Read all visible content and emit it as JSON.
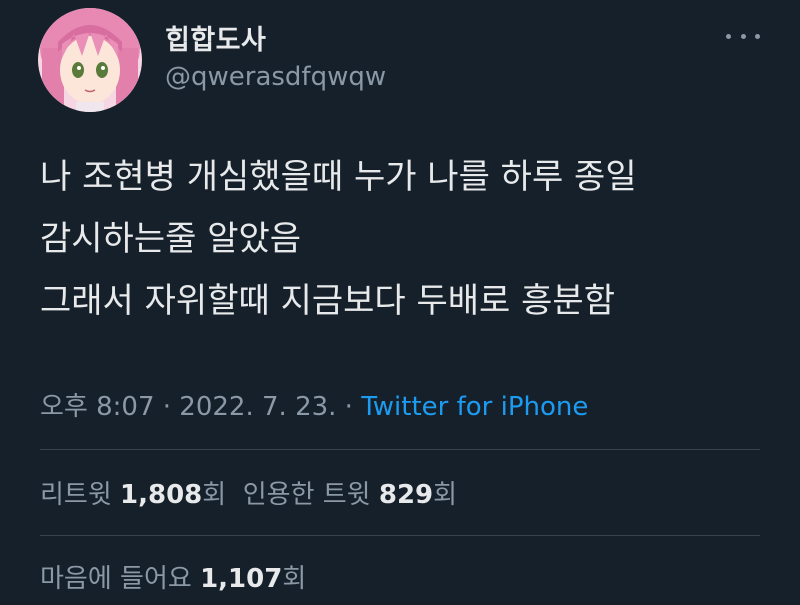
{
  "user": {
    "display_name": "힙합도사",
    "handle": "@qwerasdfqwqw",
    "avatar": "anime-pink-hair-girl-avatar"
  },
  "menu": {
    "icon": "more-horizontal-icon"
  },
  "tweet": {
    "lines": [
      "나 조현병 개심했을때 누가 나를 하루 종일",
      "감시하는줄 알았음",
      "그래서 자위할때 지금보다 두배로 흥분함"
    ]
  },
  "meta": {
    "time": "오후 8:07",
    "sep1": " · ",
    "date": "2022. 7. 23.",
    "sep2": " · ",
    "source": "Twitter for iPhone"
  },
  "stats": {
    "retweets_label": "리트윗 ",
    "retweets_count": "1,808",
    "retweets_unit": "회",
    "quotes_label": "  인용한 트윗 ",
    "quotes_count": "829",
    "quotes_unit": "회",
    "likes_label": "마음에 들어요 ",
    "likes_count": "1,107",
    "likes_unit": "회"
  },
  "colors": {
    "background": "#15202b",
    "text": "#e7e9ea",
    "secondary": "#8b98a5",
    "link": "#1d9bf0",
    "divider": "#38444d"
  }
}
